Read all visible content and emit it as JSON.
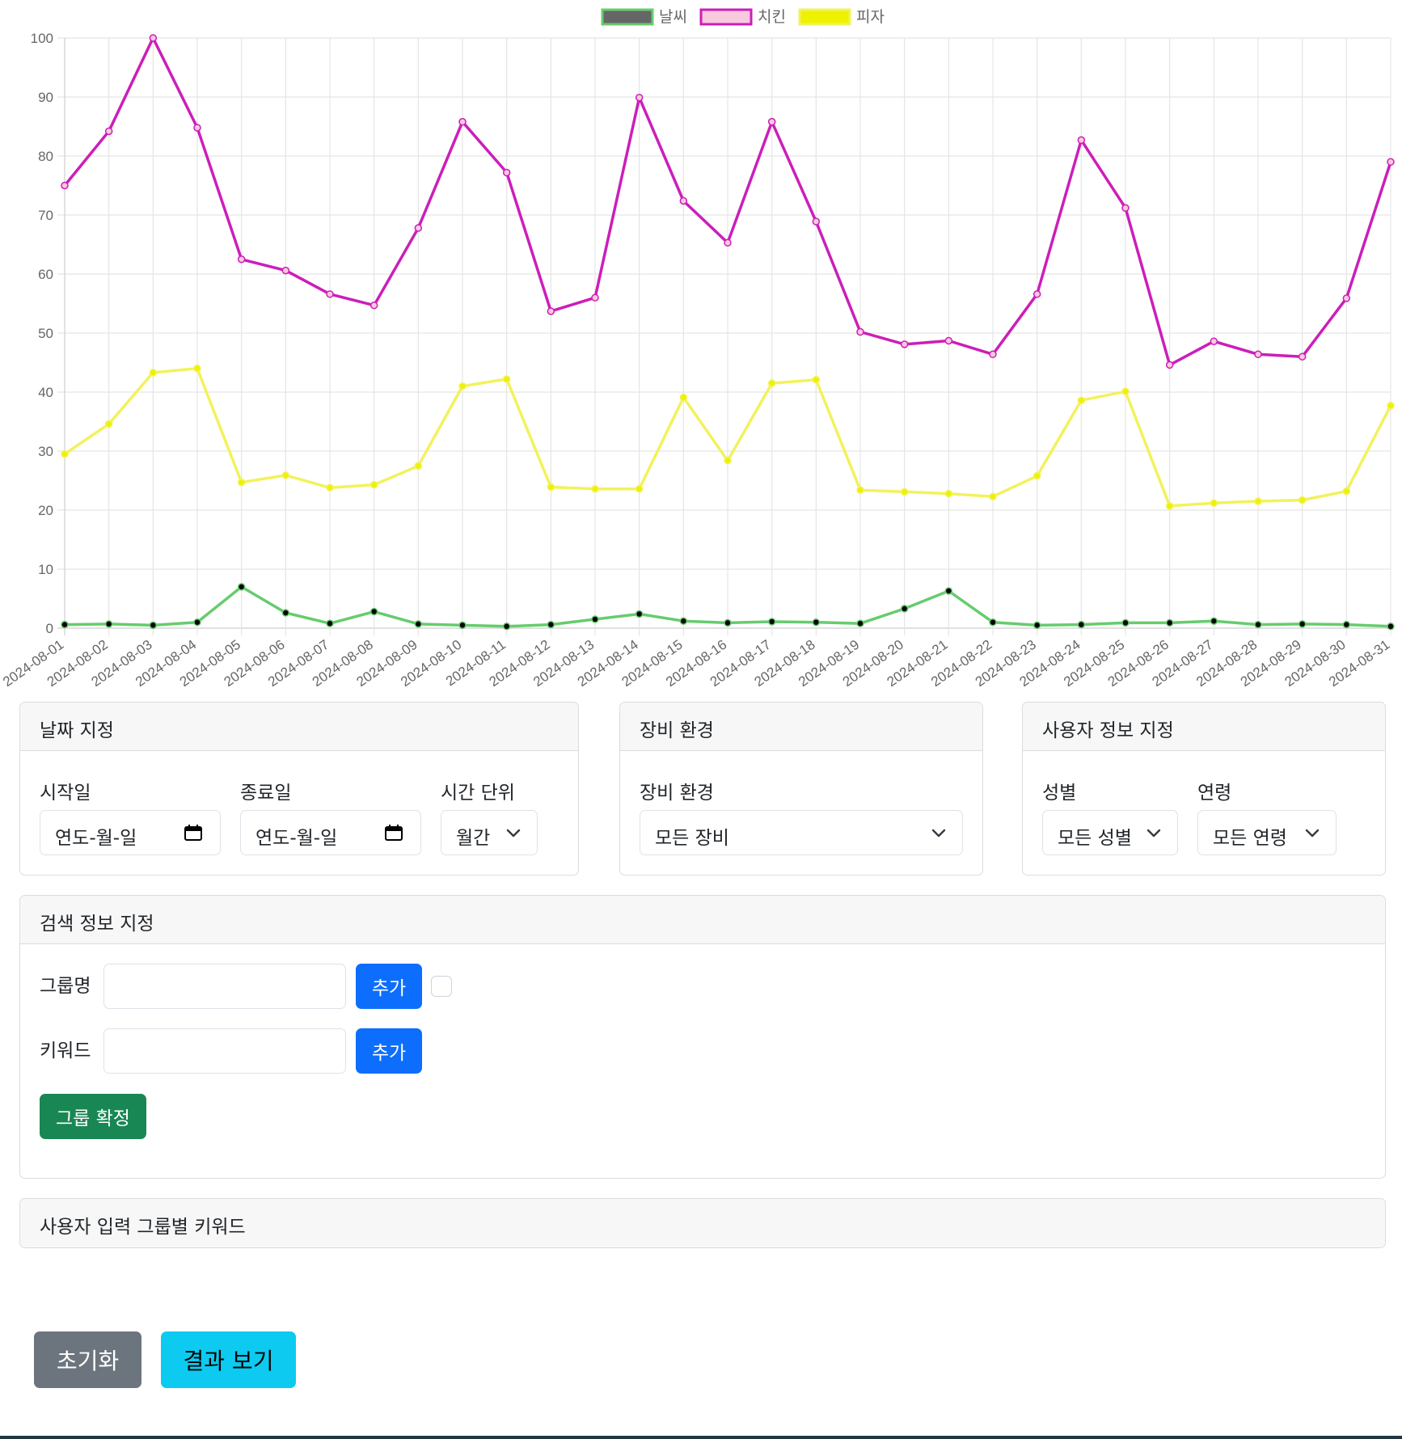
{
  "chart_data": {
    "type": "line",
    "x": [
      "2024-08-01",
      "2024-08-02",
      "2024-08-03",
      "2024-08-04",
      "2024-08-05",
      "2024-08-06",
      "2024-08-07",
      "2024-08-08",
      "2024-08-09",
      "2024-08-10",
      "2024-08-11",
      "2024-08-12",
      "2024-08-13",
      "2024-08-14",
      "2024-08-15",
      "2024-08-16",
      "2024-08-17",
      "2024-08-18",
      "2024-08-19",
      "2024-08-20",
      "2024-08-21",
      "2024-08-22",
      "2024-08-23",
      "2024-08-24",
      "2024-08-25",
      "2024-08-26",
      "2024-08-27",
      "2024-08-28",
      "2024-08-29",
      "2024-08-30",
      "2024-08-31"
    ],
    "ylim": [
      0,
      100
    ],
    "yticks": [
      0,
      10,
      20,
      30,
      40,
      50,
      60,
      70,
      80,
      90,
      100
    ],
    "grid": true,
    "legend_position": "top",
    "series": [
      {
        "name": "날씨",
        "color": "#66cc6e",
        "legend_fill": "#666666",
        "point_fill": "#000000",
        "values": [
          0.6,
          0.7,
          0.5,
          1.0,
          7.0,
          2.6,
          0.8,
          2.8,
          0.7,
          0.5,
          0.3,
          0.6,
          1.5,
          2.4,
          1.2,
          0.9,
          1.1,
          1.0,
          0.8,
          3.3,
          6.3,
          1.0,
          0.5,
          0.6,
          0.9,
          0.9,
          1.2,
          0.6,
          0.7,
          0.6,
          0.3
        ]
      },
      {
        "name": "치킨",
        "color": "#cc1eb9",
        "legend_fill": "#f9c9dd",
        "point_fill": "#f9c9dd",
        "values": [
          75.0,
          84.2,
          100.0,
          84.8,
          62.5,
          60.6,
          56.6,
          54.7,
          67.8,
          85.8,
          77.2,
          53.7,
          56.0,
          89.9,
          72.4,
          65.3,
          85.8,
          68.9,
          50.2,
          48.1,
          48.7,
          46.4,
          56.6,
          82.7,
          71.2,
          44.6,
          48.6,
          46.4,
          46.0,
          55.9,
          79.0
        ]
      },
      {
        "name": "피자",
        "color": "#f2f25c",
        "legend_fill": "#eef200",
        "point_fill": "#eef200",
        "values": [
          29.5,
          34.6,
          43.3,
          44.0,
          24.7,
          25.9,
          23.8,
          24.3,
          27.5,
          41.0,
          42.2,
          23.9,
          23.6,
          23.6,
          39.1,
          28.4,
          41.5,
          42.1,
          23.4,
          23.1,
          22.8,
          22.3,
          25.8,
          38.6,
          40.1,
          20.7,
          21.2,
          21.5,
          21.7,
          23.2,
          37.7
        ]
      }
    ]
  },
  "date_panel": {
    "title": "날짜 지정",
    "start_label": "시작일",
    "start_placeholder": "연도-월-일",
    "end_label": "종료일",
    "end_placeholder": "연도-월-일",
    "unit_label": "시간 단위",
    "unit_value": "월간"
  },
  "device_panel": {
    "title": "장비 환경",
    "label": "장비 환경",
    "value": "모든 장비"
  },
  "user_panel": {
    "title": "사용자 정보 지정",
    "gender_label": "성별",
    "gender_value": "모든 성별",
    "age_label": "연령",
    "age_value": "모든 연령"
  },
  "search_panel": {
    "title": "검색 정보 지정",
    "group_label": "그룹명",
    "group_value": "",
    "group_add": "추가",
    "keyword_label": "키워드",
    "keyword_value": "",
    "keyword_add": "추가",
    "confirm": "그룹 확정"
  },
  "keywords_panel": {
    "title": "사용자 입력 그룹별 키워드"
  },
  "actions": {
    "reset": "초기화",
    "results": "결과 보기"
  },
  "colors": {
    "primary": "#0d6efd",
    "success": "#198754",
    "secondary": "#6c757d",
    "info": "#0dcaf0"
  }
}
